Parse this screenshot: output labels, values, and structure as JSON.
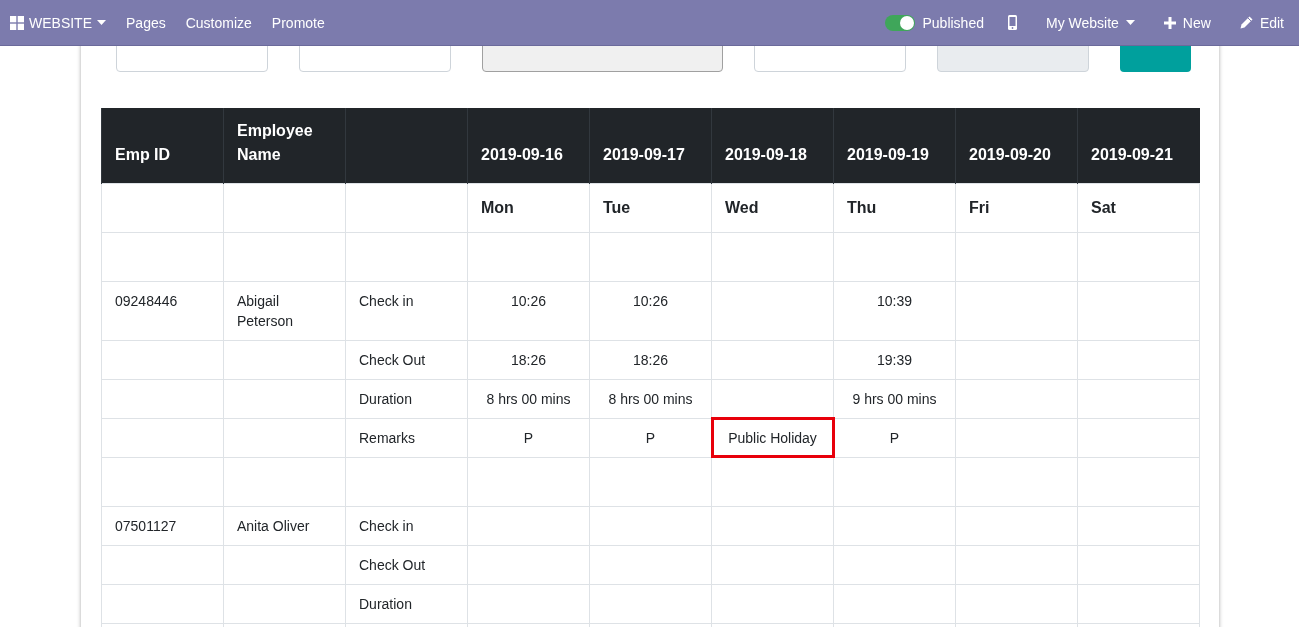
{
  "navbar": {
    "app_menu": {
      "label": "WEBSITE"
    },
    "left_items": [
      {
        "label": "Pages"
      },
      {
        "label": "Customize"
      },
      {
        "label": "Promote"
      }
    ],
    "published": {
      "label": "Published",
      "on": true
    },
    "website_menu": {
      "label": "My Website"
    },
    "new_button": {
      "label": "New"
    },
    "edit_button": {
      "label": "Edit"
    }
  },
  "filters": [
    {
      "kind": "field"
    },
    {
      "kind": "field"
    },
    {
      "kind": "select"
    },
    {
      "kind": "field"
    },
    {
      "kind": "readonly"
    },
    {
      "kind": "button"
    }
  ],
  "table": {
    "columns": [
      {
        "label": "Emp ID"
      },
      {
        "label": "Employee Name"
      },
      {},
      {
        "label": "2019-09-16"
      },
      {
        "label": "2019-09-17"
      },
      {
        "label": "2019-09-18"
      },
      {
        "label": "2019-09-19"
      },
      {
        "label": "2019-09-20"
      },
      {
        "label": "2019-09-21"
      }
    ],
    "rows": [
      {
        "kind": "days",
        "days": [
          "Mon",
          "Tue",
          "Wed",
          "Thu",
          "Fri",
          "Sat"
        ]
      },
      {
        "kind": "spacer"
      },
      {
        "kind": "entry",
        "emp_id": "09248446",
        "employee_name": "Abigail Peterson",
        "label": "Check in",
        "values": {
          "column_4": {
            "text": "10:26",
            "highlighted": false
          },
          "column_5": {
            "text": "10:26",
            "highlighted": false
          },
          "column_7": {
            "text": "10:39",
            "highlighted": false
          }
        }
      },
      {
        "kind": "entry",
        "label": "Check Out",
        "values": {
          "column_4": {
            "text": "18:26",
            "highlighted": false
          },
          "column_5": {
            "text": "18:26",
            "highlighted": false
          },
          "column_7": {
            "text": "19:39",
            "highlighted": false
          }
        }
      },
      {
        "kind": "entry",
        "label": "Duration",
        "values": {
          "column_4": {
            "text": "8 hrs 00 mins",
            "highlighted": false
          },
          "column_5": {
            "text": "8 hrs 00 mins",
            "highlighted": false
          },
          "column_7": {
            "text": "9 hrs 00 mins",
            "highlighted": false
          }
        }
      },
      {
        "kind": "entry",
        "label": "Remarks",
        "values": {
          "column_4": {
            "text": "P",
            "highlighted": false
          },
          "column_5": {
            "text": "P",
            "highlighted": false
          },
          "column_6": {
            "text": "Public Holiday",
            "highlighted": true
          },
          "column_7": {
            "text": "P",
            "highlighted": false
          }
        }
      },
      {
        "kind": "spacer"
      },
      {
        "kind": "entry",
        "emp_id": "07501127",
        "employee_name": "Anita Oliver",
        "label": "Check in"
      },
      {
        "kind": "entry",
        "label": "Check Out"
      },
      {
        "kind": "entry",
        "label": "Duration"
      },
      {
        "kind": "spacer"
      }
    ]
  }
}
